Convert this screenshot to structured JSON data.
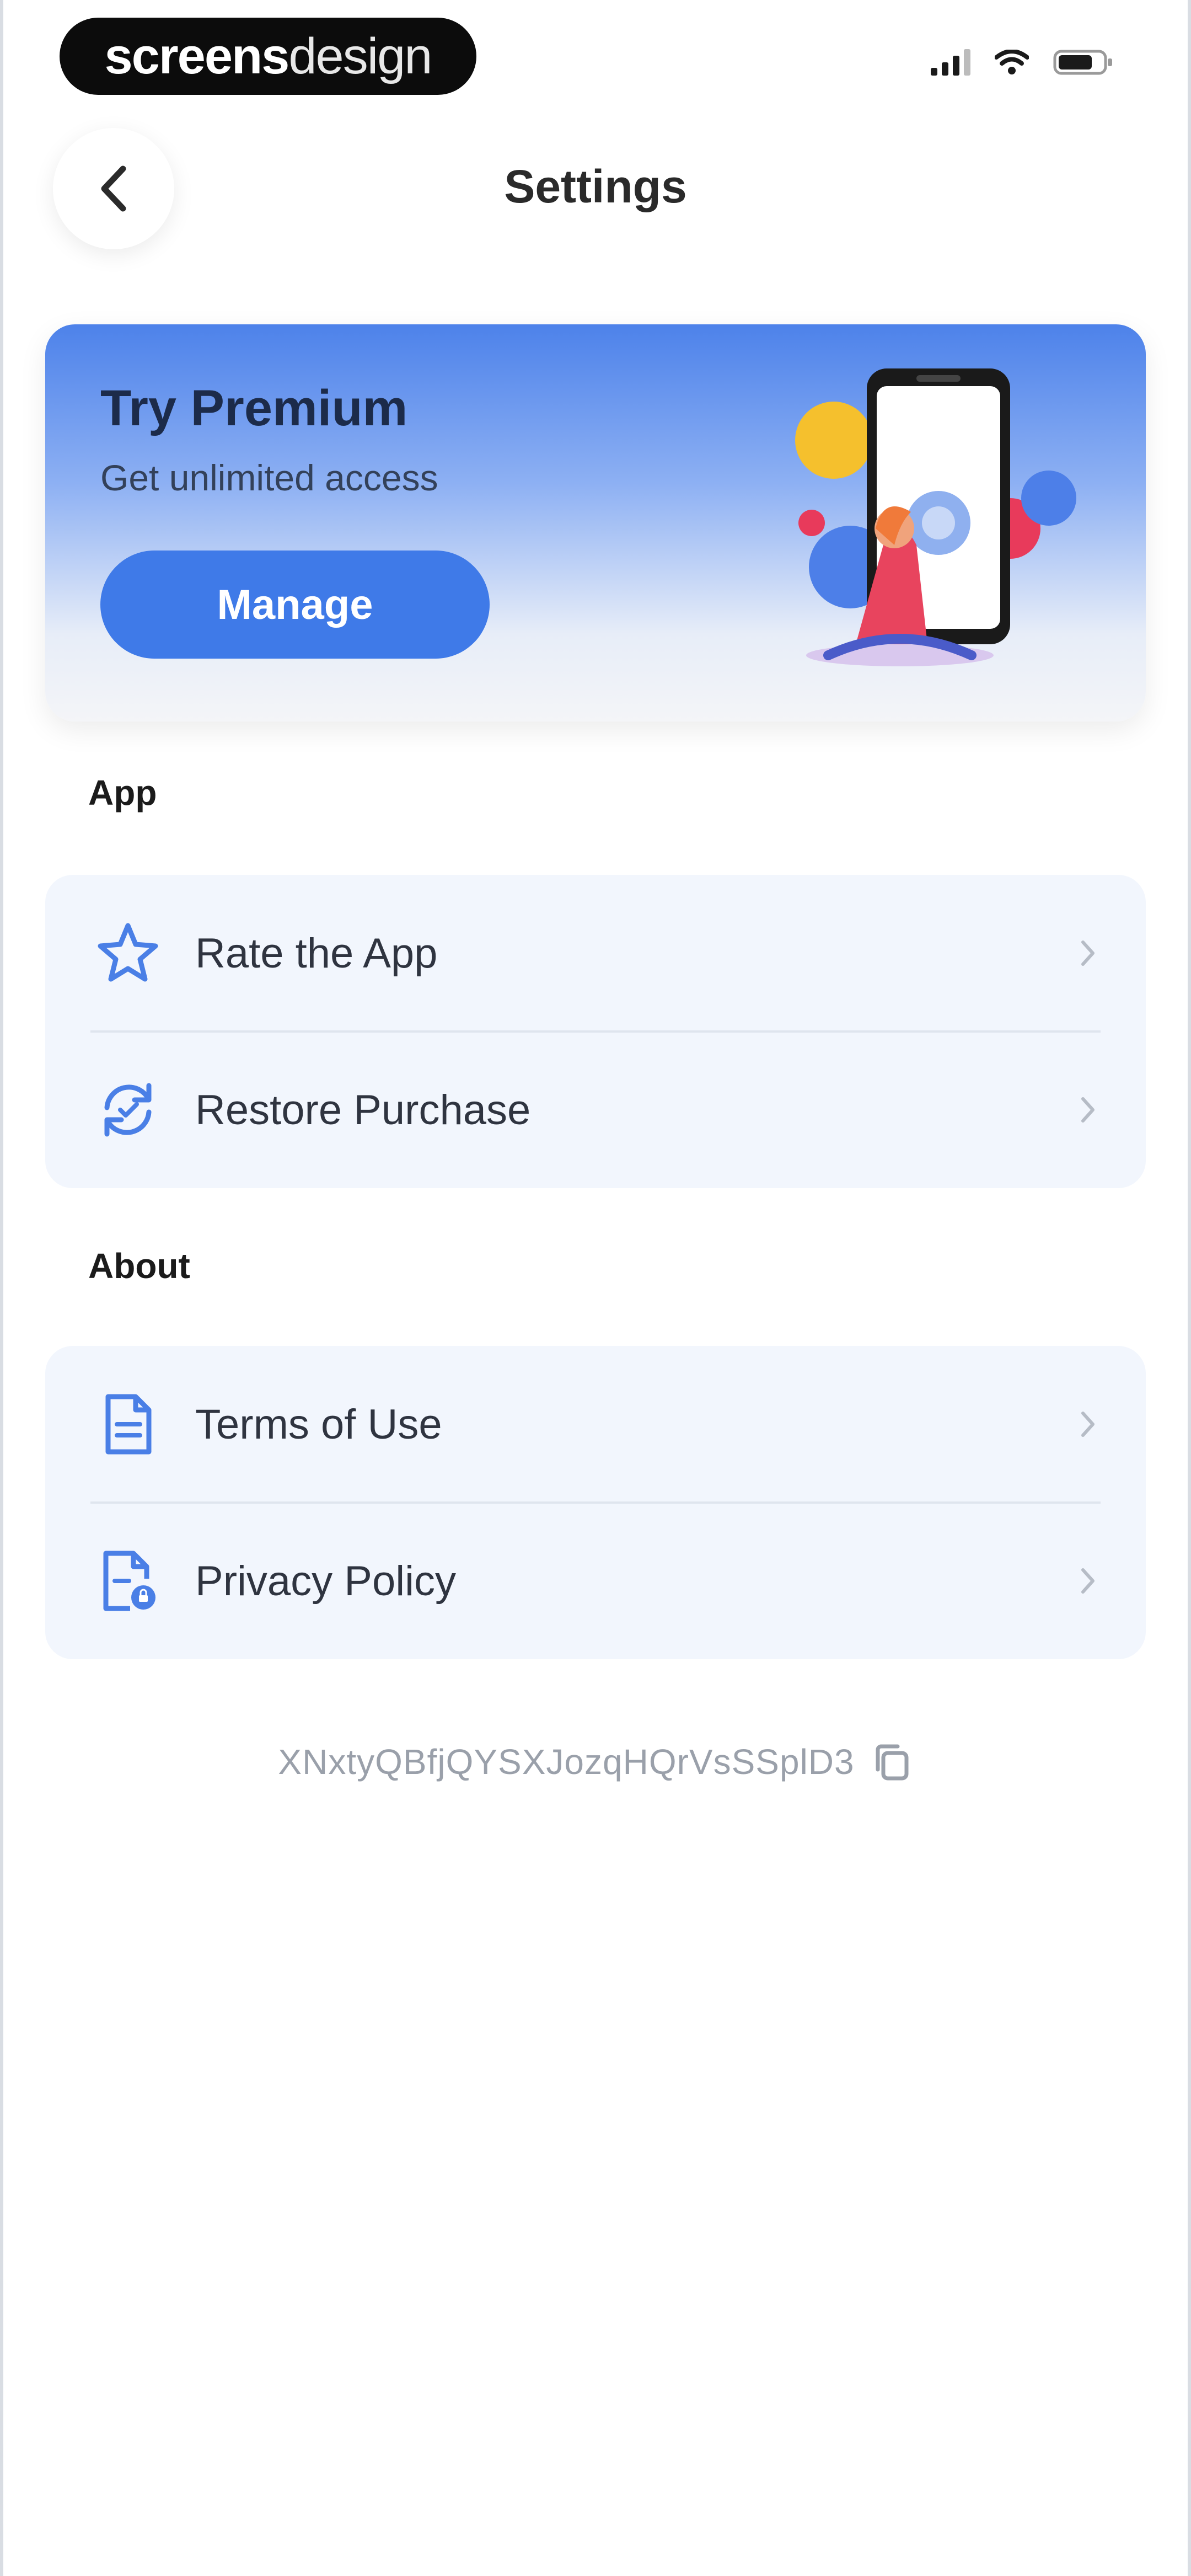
{
  "watermark": {
    "bold": "screens",
    "light": "design"
  },
  "header": {
    "title": "Settings"
  },
  "premium": {
    "title": "Try Premium",
    "subtitle": "Get unlimited access",
    "button_label": "Manage"
  },
  "sections": {
    "app": {
      "title": "App",
      "items": [
        {
          "label": "Rate the App",
          "icon": "star-icon"
        },
        {
          "label": "Restore Purchase",
          "icon": "restore-icon"
        }
      ]
    },
    "about": {
      "title": "About",
      "items": [
        {
          "label": "Terms of Use",
          "icon": "document-icon"
        },
        {
          "label": "Privacy Policy",
          "icon": "privacy-document-icon"
        }
      ]
    }
  },
  "device_id": "XNxtyQBfjQYSXJozqHQrVsSSplD3",
  "colors": {
    "accent": "#3f7ae8",
    "group_bg": "#f2f6fd",
    "icon": "#4a7fe6"
  }
}
